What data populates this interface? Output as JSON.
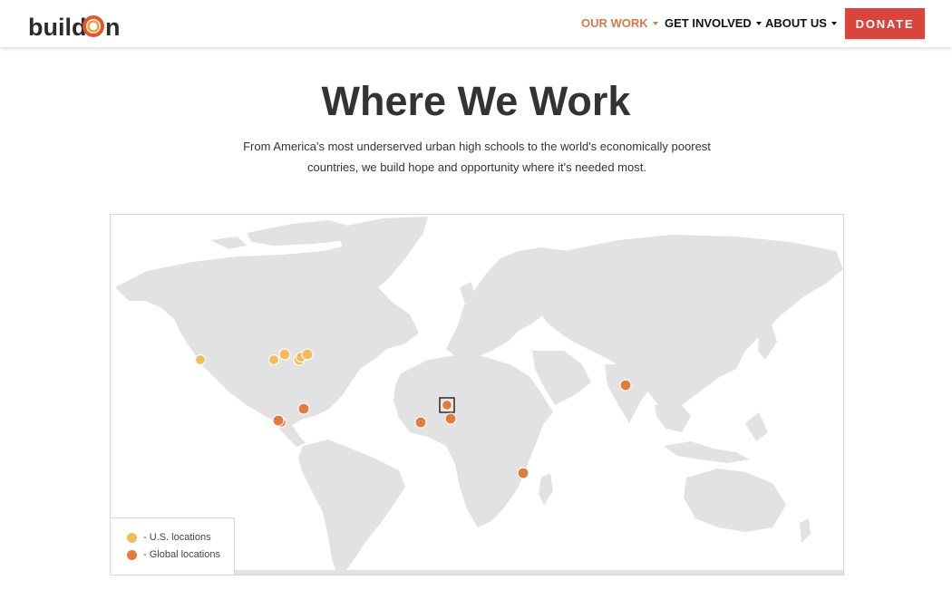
{
  "header": {
    "logo_text_left": "build",
    "logo_text_right": "n",
    "nav": [
      {
        "label": "OUR WORK",
        "active": true
      },
      {
        "label": "GET INVOLVED",
        "active": false
      },
      {
        "label": "ABOUT US",
        "active": false
      }
    ],
    "donate_label": "DONATE"
  },
  "page": {
    "title": "Where We Work",
    "subtitle": "From America's most underserved urban high schools to the world's economically poorest countries, we build hope and opportunity where it's needed most."
  },
  "map": {
    "legend": [
      {
        "label": "- U.S. locations",
        "color": "#f2bc5c"
      },
      {
        "label": "- Global locations",
        "color": "#e27b3e"
      }
    ]
  },
  "colors": {
    "accent": "#d67a48",
    "donate": "#d9453c",
    "us_marker": "#f2bc5c",
    "global_marker": "#e27b3e",
    "land": "#e2e2e2"
  }
}
